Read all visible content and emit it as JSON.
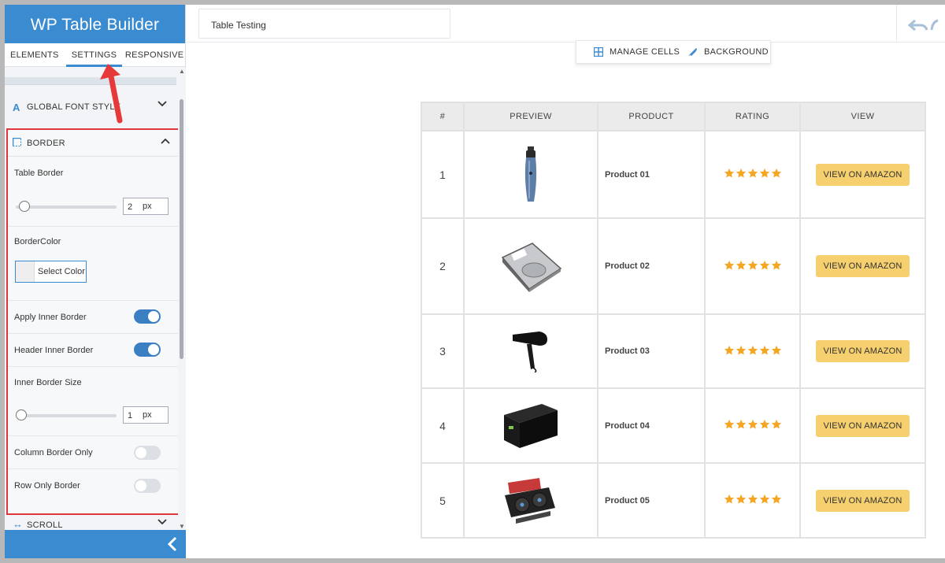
{
  "app": {
    "title": "WP Table Builder"
  },
  "tabs": [
    {
      "label": "ELEMENTS"
    },
    {
      "label": "SETTINGS",
      "active": true
    },
    {
      "label": "RESPONSIVE"
    }
  ],
  "sections": {
    "global_font_style": {
      "label": "GLOBAL FONT STYLE",
      "icon": "font-icon"
    },
    "border": {
      "label": "BORDER",
      "icon": "border-icon",
      "table_border": {
        "label": "Table Border",
        "value": "2",
        "unit": "px"
      },
      "border_color": {
        "label": "BorderColor",
        "button": "Select Color"
      },
      "apply_inner_border": {
        "label": "Apply Inner Border",
        "on": true
      },
      "header_inner_border": {
        "label": "Header Inner Border",
        "on": true
      },
      "inner_border_size": {
        "label": "Inner Border Size",
        "value": "1",
        "unit": "px"
      },
      "column_border_only": {
        "label": "Column Border Only",
        "on": false
      },
      "row_only_border": {
        "label": "Row Only Border",
        "on": false
      }
    },
    "scroll": {
      "label": "SCROLL",
      "icon": "horizontal-arrows-icon"
    }
  },
  "topbar": {
    "table_name": "Table Testing"
  },
  "toolbar": {
    "manage_cells": "MANAGE CELLS",
    "background": "BACKGROUND"
  },
  "colors": {
    "accent": "#3a8bd0",
    "highlight_border": "#e0363b",
    "star": "#f5a623",
    "amazon_button": "#f6cf6e"
  },
  "table": {
    "headers": [
      "#",
      "PREVIEW",
      "PRODUCT",
      "RATING",
      "VIEW"
    ],
    "rows": [
      {
        "num": "1",
        "product": "Product 01",
        "image": "hair-trimmer",
        "rating": 5,
        "button": "VIEW ON AMAZON"
      },
      {
        "num": "2",
        "product": "Product 02",
        "image": "hard-drive",
        "rating": 5,
        "button": "VIEW ON AMAZON"
      },
      {
        "num": "3",
        "product": "Product 03",
        "image": "hair-dryer",
        "rating": 5,
        "button": "VIEW ON AMAZON"
      },
      {
        "num": "4",
        "product": "Product 04",
        "image": "ups-box",
        "rating": 5,
        "button": "VIEW ON AMAZON"
      },
      {
        "num": "5",
        "product": "Product 05",
        "image": "graphics-card",
        "rating": 5,
        "button": "VIEW ON AMAZON"
      }
    ]
  }
}
